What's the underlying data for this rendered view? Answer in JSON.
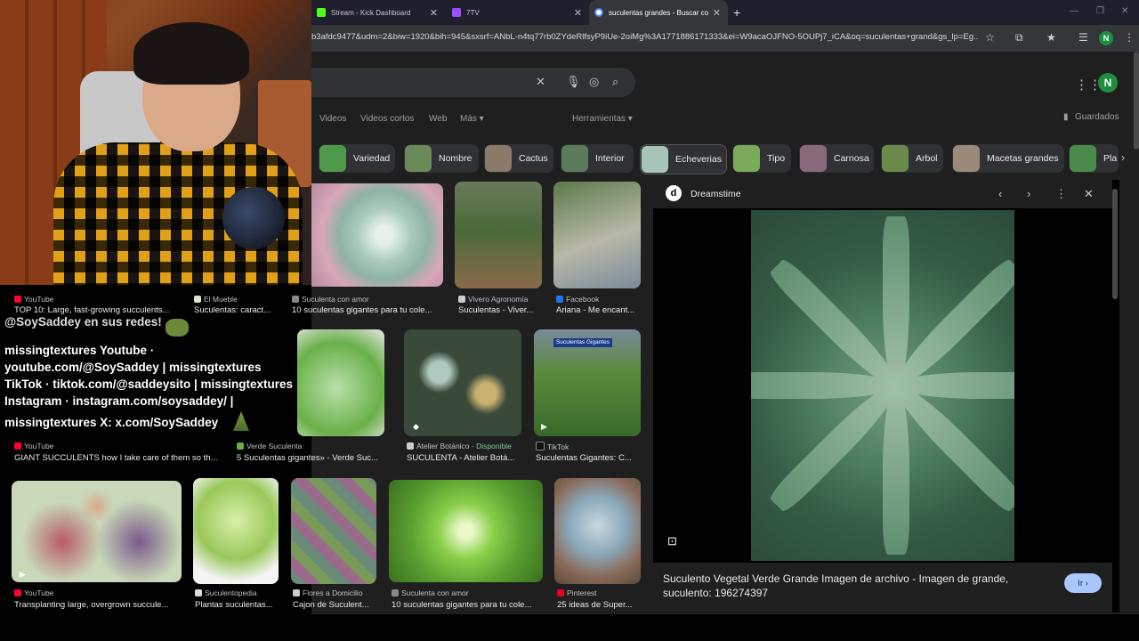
{
  "tabs": [
    {
      "label": "Stream - Kick Dashboard",
      "icon": "kick-icon",
      "color": "#53fc18"
    },
    {
      "label": "7TV",
      "icon": "7tv-icon",
      "color": "#9b4dff"
    },
    {
      "label": "suculentas grandes - Buscar co",
      "icon": "google-icon",
      "color": "#4285f4"
    }
  ],
  "url": "b3afdc9477&udm=2&biw=1920&bih=945&sxsrf=ANbL-n4tq77rb0ZYdeRlfsyP9iUe-2oiMg%3A1771886171333&ei=W9acaOJFNO-5OUPj7_iCA&oq=suculentas+grand&gs_lp=Eg...",
  "avatar_letter": "N",
  "nav": [
    "Videos",
    "Videos cortos",
    "Web",
    "Más ▾",
    "Herramientas ▾",
    "Guardados"
  ],
  "chips": [
    "Variedad",
    "Nombre",
    "Cactus",
    "Interior",
    "Echeverias",
    "Tipo",
    "Carnosa",
    "Arbol",
    "Macetas grandes",
    "Pla"
  ],
  "overlay_lines": [
    "@SoySaddey en sus redes!",
    "missingtextures Youtube ·",
    "youtube.com/@SoySaddey | missingtextures",
    "TikTok · tiktok.com/@saddeysito | missingtextures",
    "Instagram · instagram.com/soysaddey/ |",
    "missingtextures X: x.com/SoySaddey"
  ],
  "results": [
    {
      "source": "YouTube",
      "caption": "TOP 10: Large, fast-growing succulents..."
    },
    {
      "source": "El Mueble",
      "caption": "Suculentas: caract..."
    },
    {
      "source": "Suculenta con amor",
      "caption": "10 suculentas gigantes para tu cole..."
    },
    {
      "source": "Vivero Agronomía",
      "caption": "Suculentas - Viver..."
    },
    {
      "source": "Facebook",
      "caption": "Ariana - Me encant..."
    },
    {
      "source": "YouTube",
      "caption": "GIANT SUCCULENTS how I take care of them so th..."
    },
    {
      "source": "Verde Suculenta",
      "caption": "5 Suculentas gigantes» - Verde Suc..."
    },
    {
      "source": "Atelier Botánico",
      "badge": "Disponible",
      "caption": "SUCULENTA - Atelier Botá..."
    },
    {
      "source": "TikTok",
      "caption": "Suculentas Gigantes: C..."
    },
    {
      "source": "YouTube",
      "caption": "Transplanting large, overgrown succule..."
    },
    {
      "source": "Suculentopedia",
      "caption": "Plantas suculentas..."
    },
    {
      "source": "Flores a Domicilio",
      "caption": "Cajon de Suculent..."
    },
    {
      "source": "Suculenta con amor",
      "caption": "10 suculentas gigantes para tu cole..."
    },
    {
      "source": "Pinterest",
      "caption": "25 ideas de Super..."
    }
  ],
  "thumb_label": "Suculentas Gigantes",
  "panel": {
    "site": "Dreamstime",
    "caption": "Suculento Vegetal Verde Grande Imagen de archivo - Imagen de grande, suculento: 196274397",
    "visit": "Ir ›"
  },
  "colors": {
    "accent": "#a8c7fa",
    "available": "#81c995"
  }
}
